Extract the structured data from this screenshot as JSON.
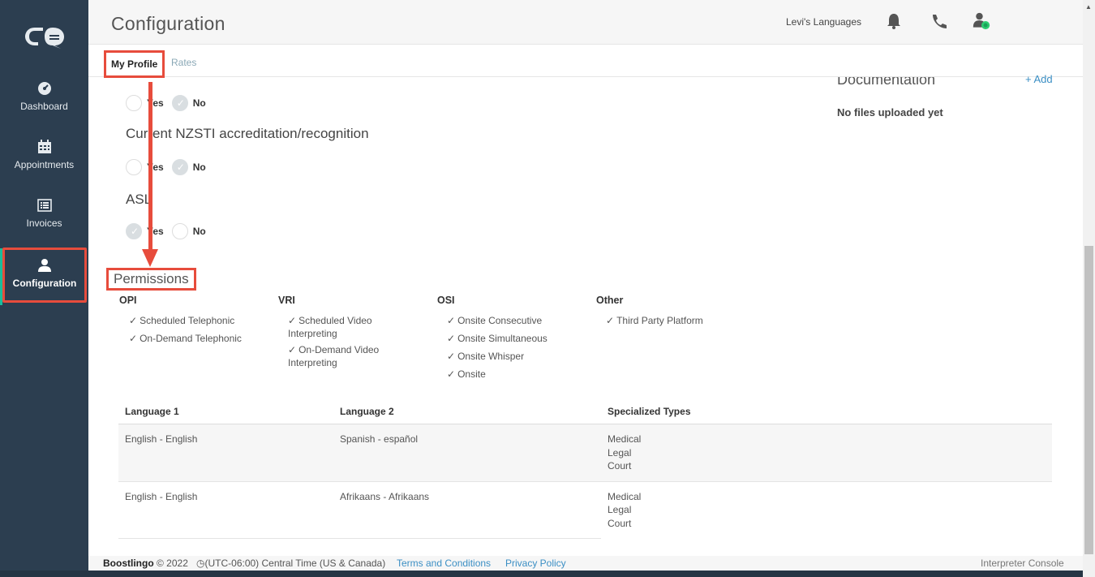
{
  "sidebar": {
    "logo": "boostlingo-logo",
    "items": [
      {
        "label": "Dashboard",
        "icon": "dashboard-icon"
      },
      {
        "label": "Appointments",
        "icon": "calendar-icon"
      },
      {
        "label": "Invoices",
        "icon": "list-icon"
      },
      {
        "label": "Configuration",
        "icon": "user-icon"
      }
    ]
  },
  "header": {
    "title": "Configuration",
    "org_name": "Levi's Languages"
  },
  "tabs": [
    {
      "label": "My Profile"
    },
    {
      "label": "Rates"
    }
  ],
  "questions": [
    {
      "title": "",
      "yes": "Yes",
      "no": "No",
      "selected": "No"
    },
    {
      "title": "Current NZSTI accreditation/recognition",
      "yes": "Yes",
      "no": "No",
      "selected": "No"
    },
    {
      "title": "ASL",
      "yes": "Yes",
      "no": "No",
      "selected": "Yes"
    }
  ],
  "documentation": {
    "title": "Documentation",
    "add_label": "+ Add",
    "empty_text": "No files uploaded yet"
  },
  "permissions": {
    "title": "Permissions",
    "groups": [
      {
        "name": "OPI",
        "items": [
          "Scheduled Telephonic",
          "On-Demand Telephonic"
        ]
      },
      {
        "name": "VRI",
        "items": [
          "Scheduled Video Interpreting",
          "On-Demand Video Interpreting"
        ]
      },
      {
        "name": "OSI",
        "items": [
          "Onsite Consecutive",
          "Onsite Simultaneous",
          "Onsite Whisper",
          "Onsite"
        ]
      },
      {
        "name": "Other",
        "items": [
          "Third Party Platform"
        ]
      }
    ]
  },
  "languages_table": {
    "columns": [
      "Language 1",
      "Language 2",
      "Specialized Types"
    ],
    "rows": [
      {
        "lang1": "English - English",
        "lang2": "Spanish - español",
        "types": [
          "Medical",
          "Legal",
          "Court"
        ]
      },
      {
        "lang1": "English - English",
        "lang2": "Afrikaans - Afrikaans",
        "types": [
          "Medical",
          "Legal",
          "Court"
        ]
      }
    ]
  },
  "footer": {
    "brand": "Boostlingo",
    "copyright": "© 2022",
    "timezone": "(UTC-06:00) Central Time (US & Canada)",
    "terms": "Terms and Conditions",
    "privacy": "Privacy Policy",
    "console": "Interpreter Console"
  },
  "colors": {
    "sidebar_bg": "#2c3e50",
    "highlight": "#e74c3c",
    "link": "#3b8fc4",
    "active_bar": "#1abc9c"
  }
}
